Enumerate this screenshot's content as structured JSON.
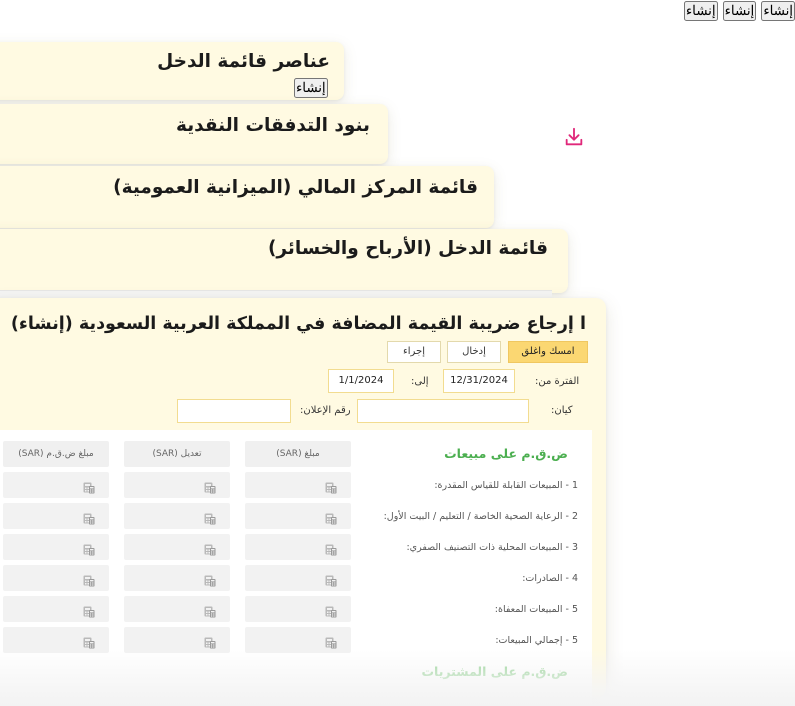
{
  "cards": [
    {
      "title": "عناصر قائمة الدخل",
      "create_label": "إنشاء"
    },
    {
      "title": "بنود التدفقات النقدية",
      "create_label": "إنشاء"
    },
    {
      "title": "قائمة المركز المالي (الميزانية العمومية)",
      "create_label": "إنشاء"
    },
    {
      "title": "قائمة الدخل (الأرباح والخسائر)",
      "create_label": "إنشاء"
    }
  ],
  "download_icon": "download-icon",
  "vat_form": {
    "title": "ا إرجاع ضريبة القيمة المضافة في المملكة العربية السعودية (إنشاء)",
    "buttons": {
      "save_close": "امسك واغلق",
      "enter": "إدخال",
      "action": "إجراء"
    },
    "period_from_label": "الفترة من:",
    "period_from_value": "12/31/2024",
    "to_label": "إلى:",
    "to_value": "1/1/2024",
    "entity_label": "كيان:",
    "entity_value": "",
    "declaration_label": "رقم الإعلان:",
    "declaration_value": ""
  },
  "table": {
    "columns": [
      "مبلغ (SAR)",
      "تعديل (SAR)",
      "مبلغ ض.ق.م (SAR)"
    ],
    "sales_section_title": "ض.ق.م على مبيعات",
    "purchases_section_title": "ض.ق.م على المشتريات",
    "rows": [
      {
        "label": "1 - المبيعات القابلة للقياس المقدرة:"
      },
      {
        "label": "2 - الرعاية الصحية الخاصة / التعليم / البيت الأول:"
      },
      {
        "label": "3 - المبيعات المحلية ذات التصنيف الصفري:"
      },
      {
        "label": "4 - الصادرات:"
      },
      {
        "label": "5 - المبيعات المعفاة:"
      },
      {
        "label": "5 - إجمالي المبيعات:"
      }
    ],
    "cell_icon": "calculator-icon",
    "section_color": "#4caf50"
  },
  "colors": {
    "card_bg": "#fffae2",
    "accent_button": "#f7b443",
    "primary_button": "#fbd772",
    "download_icon": "#e0287a"
  }
}
